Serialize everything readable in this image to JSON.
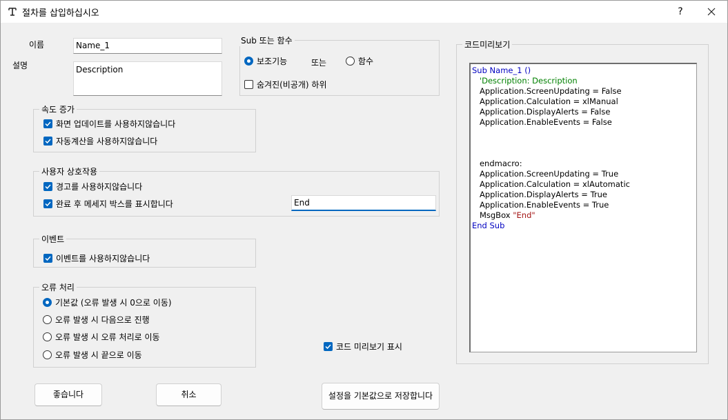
{
  "window": {
    "title": "절차를 삽입하십시오",
    "help": "?",
    "close": "✕"
  },
  "name": {
    "label": "이름",
    "value": "Name_1"
  },
  "desc": {
    "label": "설명",
    "value": "Description"
  },
  "sub_or_func": {
    "legend": "Sub 또는 함수",
    "sub": "보조기능",
    "or": "또는",
    "func": "함수",
    "hidden": "숨겨진(비공개) 하위"
  },
  "speed": {
    "legend": "속도 증가",
    "screen": "화면 업데이트를 사용하지않습니다",
    "calc": "자동계산을 사용하지않습니다"
  },
  "interaction": {
    "legend": "사용자 상호작용",
    "warning": "경고를 사용하지않습니다",
    "done_msg": "완료 후 메세지 박스를 표시합니다",
    "done_value": "End"
  },
  "events": {
    "legend": "이벤트",
    "disable": "이벤트를 사용하지않습니다"
  },
  "errors": {
    "legend": "오류 처리",
    "opt1": "기본값 (오류 발생 시 0으로 이동)",
    "opt2": "오류 발생 시 다음으로 진행",
    "opt3": "오류 발생 시 오류 처리로 이동",
    "opt4": "오류 발생 시 끝으로 이동"
  },
  "show_preview": "코드 미리보기 표시",
  "buttons": {
    "ok": "좋습니다",
    "cancel": "취소",
    "save_default": "설정을 기본값으로 저장합니다"
  },
  "preview": {
    "legend": "코드미리보기",
    "lines": [
      {
        "kind": "kw",
        "text": "Sub Name_1 ()"
      },
      {
        "kind": "cm",
        "text": "   'Description: Description"
      },
      {
        "kind": "tx",
        "text": "   Application.ScreenUpdating = False"
      },
      {
        "kind": "tx",
        "text": "   Application.Calculation = xlManual"
      },
      {
        "kind": "tx",
        "text": "   Application.DisplayAlerts = False"
      },
      {
        "kind": "tx",
        "text": "   Application.EnableEvents = False"
      },
      {
        "kind": "tx",
        "text": ""
      },
      {
        "kind": "tx",
        "text": ""
      },
      {
        "kind": "tx",
        "text": ""
      },
      {
        "kind": "tx",
        "text": "   endmacro:"
      },
      {
        "kind": "tx",
        "text": "   Application.ScreenUpdating = True"
      },
      {
        "kind": "tx",
        "text": "   Application.Calculation = xlAutomatic"
      },
      {
        "kind": "tx",
        "text": "   Application.DisplayAlerts = True"
      },
      {
        "kind": "tx",
        "text": "   Application.EnableEvents = True"
      },
      {
        "kind": "msg",
        "text": "   MsgBox ",
        "str": "\"End\""
      },
      {
        "kind": "kw",
        "text": "End Sub"
      }
    ]
  },
  "colors": {
    "accent": "#0067c0",
    "keyword": "#0000c0",
    "comment": "#008000",
    "string": "#a31515"
  }
}
